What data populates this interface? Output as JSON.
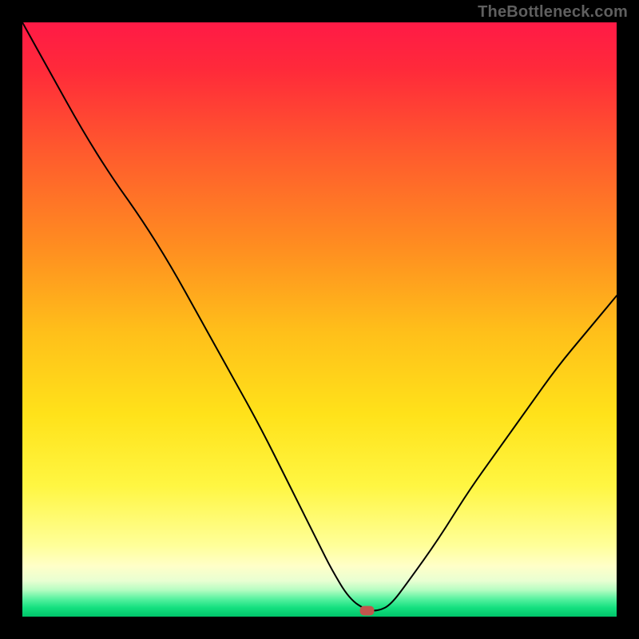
{
  "watermark": "TheBottleneck.com",
  "chart_data": {
    "type": "line",
    "title": "",
    "xlabel": "",
    "ylabel": "",
    "xlim": [
      0,
      100
    ],
    "ylim": [
      0,
      100
    ],
    "grid": false,
    "legend": false,
    "annotations": [],
    "background": {
      "type": "vertical-gradient",
      "stops": [
        {
          "pos": 0,
          "color": "#ff1a46"
        },
        {
          "pos": 0.08,
          "color": "#ff2a3a"
        },
        {
          "pos": 0.22,
          "color": "#ff5b2d"
        },
        {
          "pos": 0.38,
          "color": "#ff8e20"
        },
        {
          "pos": 0.52,
          "color": "#ffbf1a"
        },
        {
          "pos": 0.66,
          "color": "#ffe21a"
        },
        {
          "pos": 0.78,
          "color": "#fff642"
        },
        {
          "pos": 0.88,
          "color": "#ffff99"
        },
        {
          "pos": 0.915,
          "color": "#ffffc8"
        },
        {
          "pos": 0.94,
          "color": "#e8ffd2"
        },
        {
          "pos": 0.955,
          "color": "#b6fdc2"
        },
        {
          "pos": 0.97,
          "color": "#58f2a0"
        },
        {
          "pos": 0.985,
          "color": "#14e07f"
        },
        {
          "pos": 1.0,
          "color": "#00c46a"
        }
      ]
    },
    "series": [
      {
        "name": "bottleneck-curve",
        "stroke": "#000000",
        "stroke_width": 2,
        "x": [
          0,
          5,
          10,
          15,
          20,
          25,
          30,
          35,
          40,
          45,
          50,
          52,
          55,
          58,
          60,
          62,
          65,
          70,
          75,
          80,
          85,
          90,
          95,
          100
        ],
        "y": [
          100,
          91,
          82,
          74,
          67,
          59,
          50,
          41,
          32,
          22,
          12,
          8,
          3,
          1,
          1,
          2,
          6,
          13,
          21,
          28,
          35,
          42,
          48,
          54
        ]
      }
    ],
    "marker": {
      "name": "optimum-point",
      "shape": "rounded-rect",
      "x": 58,
      "y": 1,
      "color": "#c2564d",
      "width_pct": 2.4,
      "height_pct": 1.6
    }
  }
}
